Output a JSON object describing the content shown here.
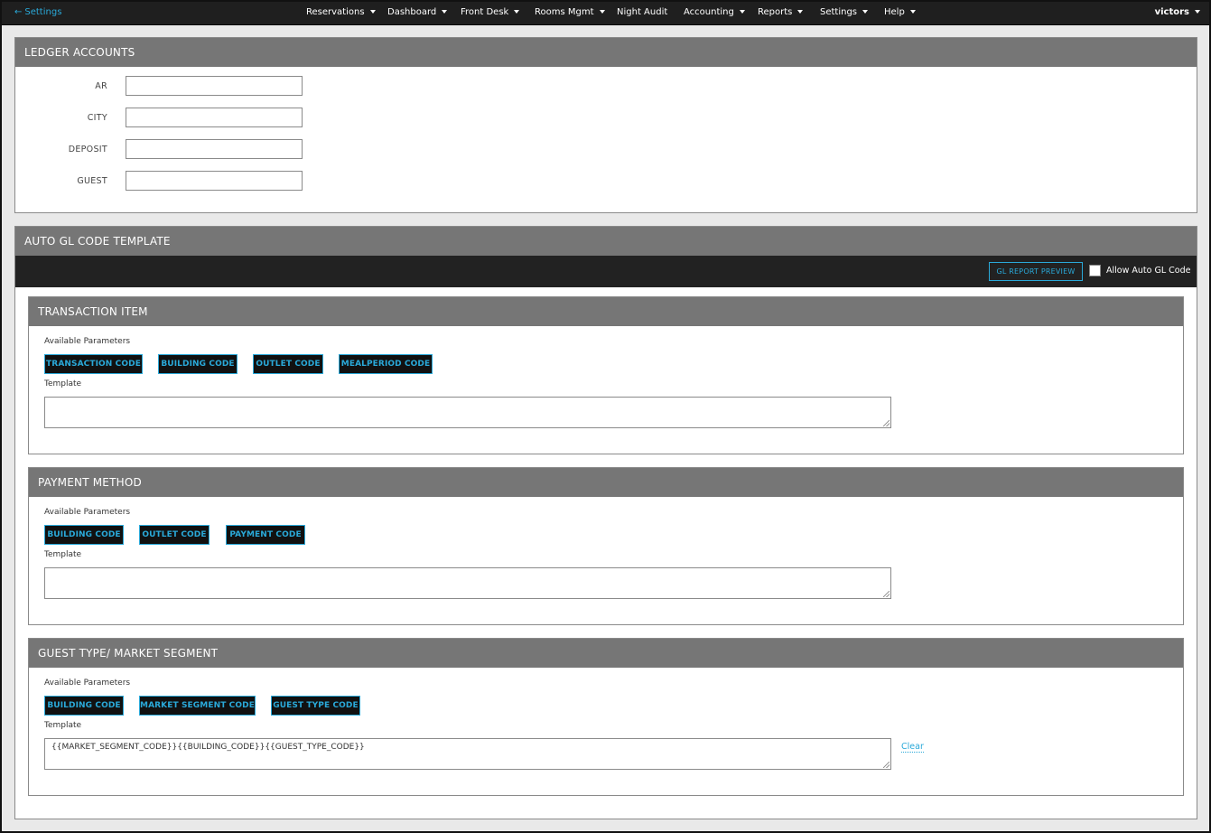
{
  "nav": {
    "back_label": "Settings",
    "items": [
      {
        "label": "Reservations",
        "caret": true
      },
      {
        "label": "Dashboard",
        "caret": true
      },
      {
        "label": "Front Desk",
        "caret": true
      },
      {
        "label": "Rooms Mgmt",
        "caret": true
      },
      {
        "label": "Night Audit",
        "caret": false
      },
      {
        "label": "Accounting",
        "caret": true
      },
      {
        "label": "Reports",
        "caret": true
      },
      {
        "label": "Settings",
        "caret": true
      },
      {
        "label": "Help",
        "caret": true
      }
    ],
    "user": "victors"
  },
  "ledger": {
    "title": "LEDGER ACCOUNTS",
    "fields": [
      {
        "label": "AR",
        "value": ""
      },
      {
        "label": "CITY",
        "value": ""
      },
      {
        "label": "DEPOSIT",
        "value": ""
      },
      {
        "label": "GUEST",
        "value": ""
      }
    ]
  },
  "auto_gl": {
    "title": "AUTO GL CODE TEMPLATE",
    "preview_button": "GL REPORT PREVIEW",
    "allow_label": "Allow Auto GL Code",
    "allow_checked": false,
    "available_label": "Available Parameters",
    "template_label": "Template",
    "clear_label": "Clear",
    "sections": [
      {
        "title": "TRANSACTION ITEM",
        "params": [
          "TRANSACTION CODE",
          "BUILDING CODE",
          "OUTLET CODE",
          "MEALPERIOD CODE"
        ],
        "template": ""
      },
      {
        "title": "PAYMENT METHOD",
        "params": [
          "BUILDING CODE",
          "OUTLET CODE",
          "PAYMENT CODE"
        ],
        "template": ""
      },
      {
        "title": "GUEST TYPE/ MARKET SEGMENT",
        "params": [
          "BUILDING CODE",
          "MARKET SEGMENT CODE",
          "GUEST TYPE CODE"
        ],
        "template": "{{MARKET_SEGMENT_CODE}}{{BUILDING_CODE}}{{GUEST_TYPE_CODE}}"
      }
    ]
  },
  "colors": {
    "accent": "#2aa9d9",
    "nav_bg": "#1f1f1f",
    "panel_head": "#767676",
    "toolbar_bg": "#222222"
  }
}
